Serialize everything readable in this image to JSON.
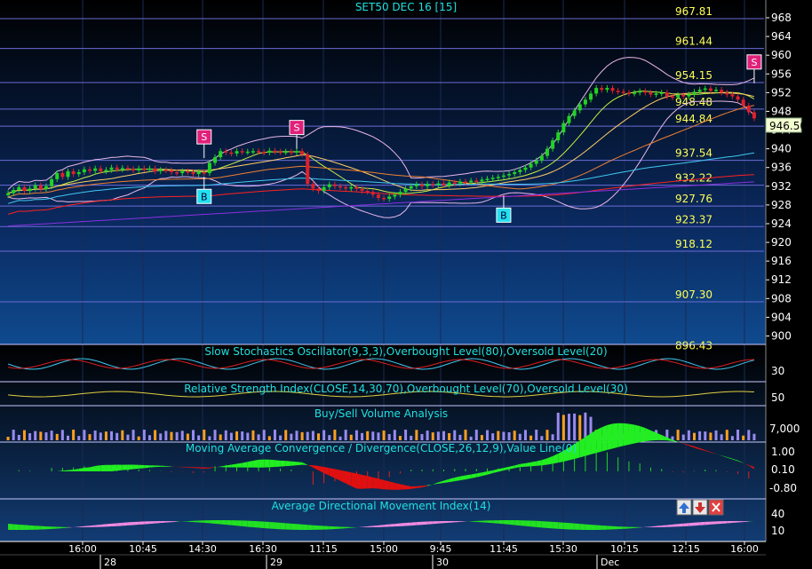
{
  "window": {
    "title": "SET50 DEC 16  [15]"
  },
  "last_price_label": "946.50",
  "colors": {
    "background_top": "#000000",
    "background_bottom": "#0d3a78",
    "grid": "#6b6bd6",
    "price_axis_text": "#ffffff",
    "level_text": "#ffff55",
    "up_candle": "#22d422",
    "down_candle": "#e0202a",
    "sell_marker": "#e0207a",
    "buy_marker": "#22e0f0",
    "panel_title": "#20e0e0"
  },
  "price_axis_ticks": [
    "968",
    "964",
    "960",
    "956",
    "952",
    "948",
    "944",
    "940",
    "936",
    "932",
    "928",
    "924",
    "920",
    "916",
    "912",
    "908",
    "904",
    "900"
  ],
  "levels": [
    "967.81",
    "961.44",
    "954.15",
    "948.48",
    "944.84",
    "937.54",
    "932.22",
    "927.76",
    "923.37",
    "918.12",
    "907.30",
    "896.43"
  ],
  "signals": {
    "sell": "S",
    "buy": "B"
  },
  "panels": {
    "stochastic": {
      "title": "Slow Stochastics Oscillator(9,3,3),Overbought Level(80),Oversold Level(20)",
      "axis": [
        "30"
      ]
    },
    "rsi": {
      "title": "Relative Strength Index(CLOSE,14,30,70),Overbought Level(70),Oversold Level(30)",
      "axis": [
        "50"
      ]
    },
    "volume": {
      "title": "Buy/Sell Volume Analysis",
      "axis": [
        "7,000"
      ]
    },
    "macd": {
      "title": "Moving Average Convergence / Divergence(CLOSE,26,12,9),Value Line(0)",
      "axis": [
        "1.00",
        "0.10",
        "-0.80"
      ]
    },
    "adx": {
      "title": "Average Directional Movement Index(14)",
      "axis": [
        "40",
        "10"
      ]
    }
  },
  "time_axis": {
    "times": [
      "16:00",
      "10:45",
      "14:30",
      "16:30",
      "11:15",
      "15:00",
      "9:45",
      "11:45",
      "15:30",
      "10:15",
      "12:15",
      "16:00"
    ],
    "dates": [
      "28",
      "29",
      "30",
      "Dec"
    ]
  },
  "chart_data": {
    "type": "candlestick",
    "title": "SET50 DEC 16  [15]",
    "ylim": [
      898,
      970
    ],
    "y_ticks": [
      968,
      964,
      960,
      956,
      952,
      948,
      944,
      940,
      936,
      932,
      928,
      924,
      920,
      916,
      912,
      908,
      904,
      900
    ],
    "last_price": 946.5,
    "horizontal_levels": [
      967.81,
      961.44,
      954.15,
      948.48,
      944.84,
      937.54,
      932.22,
      927.76,
      923.37,
      918.12,
      907.3,
      896.43
    ],
    "close_series": [
      930.5,
      931.2,
      931.8,
      931.0,
      931.5,
      932.2,
      931.4,
      932.0,
      933.5,
      934.8,
      934.0,
      935.2,
      934.6,
      935.0,
      935.6,
      935.3,
      935.8,
      935.2,
      935.5,
      936.0,
      935.6,
      935.9,
      935.7,
      935.4,
      935.8,
      935.6,
      935.8,
      935.2,
      935.5,
      935.4,
      935.0,
      934.8,
      935.2,
      935.0,
      934.6,
      935.0,
      934.8,
      937.0,
      938.2,
      939.5,
      939.2,
      939.0,
      939.5,
      939.3,
      939.4,
      939.5,
      939.3,
      939.2,
      939.6,
      939.4,
      939.3,
      939.4,
      939.2,
      939.5,
      938.8,
      932.5,
      931.5,
      931.0,
      931.8,
      932.4,
      932.0,
      931.8,
      931.5,
      931.8,
      931.4,
      931.0,
      930.8,
      930.2,
      929.5,
      929.3,
      929.8,
      930.2,
      930.8,
      931.5,
      932.0,
      932.4,
      932.0,
      932.5,
      932.3,
      932.6,
      932.2,
      932.8,
      932.6,
      933.0,
      932.8,
      933.2,
      933.0,
      933.4,
      933.6,
      933.8,
      934.0,
      934.3,
      934.6,
      935.0,
      935.5,
      936.0,
      936.8,
      937.5,
      938.5,
      940.0,
      941.8,
      943.5,
      945.5,
      947.0,
      948.2,
      949.5,
      950.5,
      951.8,
      953.0,
      952.6,
      953.0,
      952.4,
      952.2,
      952.0,
      951.8,
      952.0,
      952.3,
      952.0,
      951.6,
      951.8,
      952.0,
      951.2,
      951.0,
      951.5,
      951.2,
      951.6,
      952.2,
      952.6,
      952.9,
      952.4,
      952.6,
      952.0,
      951.6,
      951.2,
      950.5,
      949.2,
      947.8,
      946.5
    ],
    "buy_signals": [
      {
        "time_label": "16:30",
        "date": "29"
      },
      {
        "time_label": "11:45",
        "date": "30"
      }
    ],
    "sell_signals": [
      {
        "time_label": "16:30",
        "date": "29"
      },
      {
        "time_label": "15:00",
        "date": "29"
      },
      {
        "time_label": "16:00",
        "date": "Dec"
      }
    ],
    "x_ticks": [
      "16:00",
      "10:45",
      "14:30",
      "16:30",
      "11:15",
      "15:00",
      "9:45",
      "11:45",
      "15:30",
      "10:15",
      "12:15",
      "16:00"
    ],
    "x_dates": [
      "28",
      "29",
      "30",
      "Dec"
    ]
  }
}
